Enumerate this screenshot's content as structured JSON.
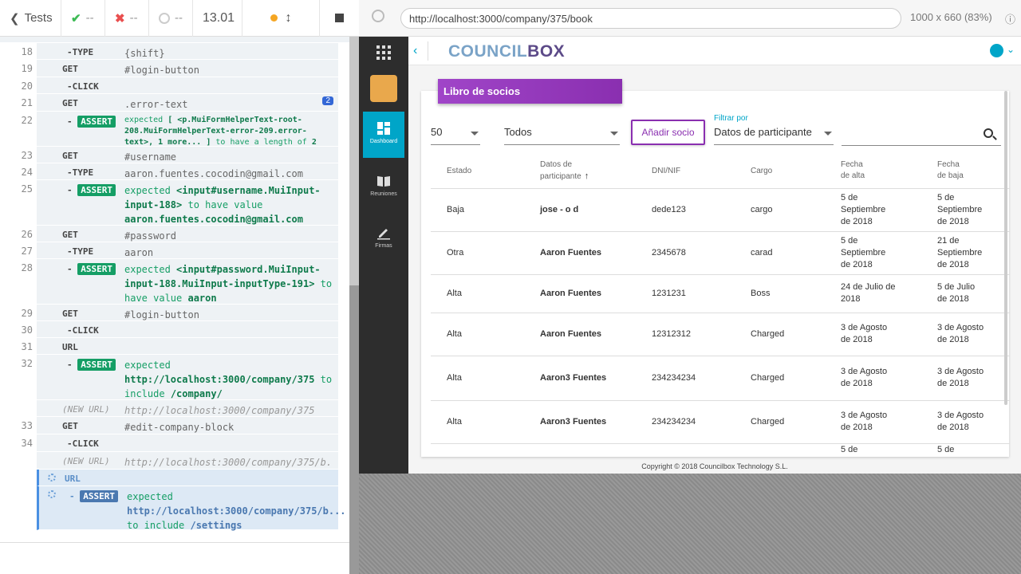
{
  "runner": {
    "tests_label": "Tests",
    "passed": "--",
    "failed": "--",
    "pending": "--",
    "duration": "13.01"
  },
  "aut_header": {
    "url": "http://localhost:3000/company/375/book",
    "viewport": "1000 x 660",
    "scale": "(83%)"
  },
  "commands": [
    {
      "num": "18",
      "name": "-TYPE",
      "msg": "{shift}"
    },
    {
      "num": "19",
      "name": "GET",
      "msg": "#login-button"
    },
    {
      "num": "20",
      "name": "-CLICK",
      "msg": ""
    },
    {
      "num": "21",
      "name": "GET",
      "msg": ".error-text",
      "badge": "2"
    },
    {
      "num": "22",
      "name": "-ASSERT",
      "msg_a": "expected",
      "msg_b": "[ <p.MuiFormHelperText-root-208.MuiFormHelperText-error-209.error-text>, 1 more... ]",
      "msg_c": "to have a length of",
      "msg_d": "2"
    },
    {
      "num": "23",
      "name": "GET",
      "msg": "#username"
    },
    {
      "num": "24",
      "name": "-TYPE",
      "msg": "aaron.fuentes.cocodin@gmail.com"
    },
    {
      "num": "25",
      "name": "-ASSERT",
      "msg_a": "expected",
      "msg_b": "<input#username.MuiInput-input-188>",
      "msg_c": "to have value",
      "msg_d": "aaron.fuentes.cocodin@gmail.com"
    },
    {
      "num": "26",
      "name": "GET",
      "msg": "#password"
    },
    {
      "num": "27",
      "name": "-TYPE",
      "msg": "aaron"
    },
    {
      "num": "28",
      "name": "-ASSERT",
      "msg_a": "expected",
      "msg_b": "<input#password.MuiInput-input-188.MuiInput-inputType-191>",
      "msg_c": "to have value",
      "msg_d": "aaron"
    },
    {
      "num": "29",
      "name": "GET",
      "msg": "#login-button"
    },
    {
      "num": "30",
      "name": "-CLICK",
      "msg": ""
    },
    {
      "num": "31",
      "name": "URL",
      "msg": ""
    },
    {
      "num": "32",
      "name": "-ASSERT",
      "msg_a": "expected",
      "msg_b": "http://localhost:3000/company/375",
      "msg_c": "to include",
      "msg_d": "/company/"
    },
    {
      "num": "",
      "name": "(NEW URL)",
      "msg": "http://localhost:3000/company/375"
    },
    {
      "num": "33",
      "name": "GET",
      "msg": "#edit-company-block"
    },
    {
      "num": "34",
      "name": "-CLICK",
      "msg": ""
    },
    {
      "num": "",
      "name": "(NEW URL)",
      "msg": "http://localhost:3000/company/375/b..."
    },
    {
      "num": "",
      "name": "URL",
      "msg": ""
    },
    {
      "num": "",
      "name": "-ASSERT",
      "msg_a": "expected",
      "msg_b": "http://localhost:3000/company/375/b...",
      "msg_c": "to include",
      "msg_d": "/settings"
    }
  ],
  "app": {
    "logo_a": "COUNCIL",
    "logo_b": "BOX",
    "nav": [
      {
        "label": "Dashboard"
      },
      {
        "label": "Reuniones"
      },
      {
        "label": "Firmas"
      }
    ],
    "card_title": "Libro de socios",
    "page_size": "50",
    "status_filter": "Todos",
    "add_button": "Añadir socio",
    "filter_label": "Filtrar por",
    "filter_field": "Datos de participante",
    "copyright": "Copyright © 2018 Councilbox Technology S.L.",
    "columns": [
      "Estado",
      "Datos de\nparticipante",
      "DNI/NIF",
      "Cargo",
      "Fecha\nde alta",
      "Fecha\nde baja"
    ],
    "rows": [
      {
        "estado": "Baja",
        "nombre": "jose - o d",
        "dni": "dede123",
        "cargo": "cargo",
        "alta": "5 de Septiembre de 2018",
        "baja": "5 de Septiembre de 2018"
      },
      {
        "estado": "Otra",
        "nombre": "Aaron Fuentes",
        "dni": "2345678",
        "cargo": "carad",
        "alta": "5 de Septiembre de 2018",
        "baja": "21 de Septiembre de 2018"
      },
      {
        "estado": "Alta",
        "nombre": "Aaron Fuentes",
        "dni": "1231231",
        "cargo": "Boss",
        "alta": "24 de Julio de 2018",
        "baja": "5 de Julio de 2018"
      },
      {
        "estado": "Alta",
        "nombre": "Aaron Fuentes",
        "dni": "12312312",
        "cargo": "Charged",
        "alta": "3 de Agosto de 2018",
        "baja": "3 de Agosto de 2018"
      },
      {
        "estado": "Alta",
        "nombre": "Aaron3 Fuentes",
        "dni": "234234234",
        "cargo": "Charged",
        "alta": "3 de Agosto de 2018",
        "baja": "3 de Agosto de 2018"
      },
      {
        "estado": "Alta",
        "nombre": "Aaron3 Fuentes",
        "dni": "234234234",
        "cargo": "Charged",
        "alta": "3 de Agosto de 2018",
        "baja": "3 de Agosto de 2018"
      },
      {
        "estado": "",
        "nombre": "",
        "dni": "",
        "cargo": "",
        "alta": "5 de",
        "baja": "5 de"
      }
    ]
  }
}
